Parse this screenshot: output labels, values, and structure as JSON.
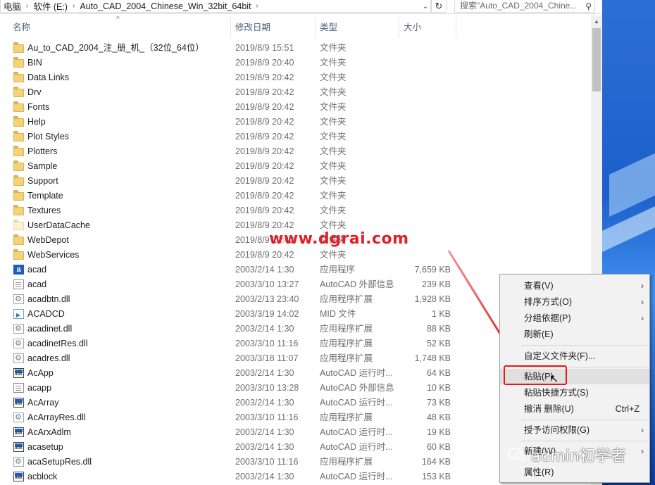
{
  "address": {
    "segments": [
      "电脑",
      "软件 (E:)",
      "Auto_CAD_2004_Chinese_Win_32bit_64bit"
    ],
    "search_placeholder": "搜索\"Auto_CAD_2004_Chine..."
  },
  "columns": {
    "name": "名称",
    "date": "修改日期",
    "type": "类型",
    "size": "大小"
  },
  "files": [
    {
      "name": "Au_to_CAD_2004_注_册_机_（32位_64位）",
      "date": "2019/8/9 15:51",
      "type": "文件夹",
      "size": "",
      "icon": "folder"
    },
    {
      "name": "BIN",
      "date": "2019/8/9 20:40",
      "type": "文件夹",
      "size": "",
      "icon": "folder"
    },
    {
      "name": "Data Links",
      "date": "2019/8/9 20:42",
      "type": "文件夹",
      "size": "",
      "icon": "folder"
    },
    {
      "name": "Drv",
      "date": "2019/8/9 20:42",
      "type": "文件夹",
      "size": "",
      "icon": "folder"
    },
    {
      "name": "Fonts",
      "date": "2019/8/9 20:42",
      "type": "文件夹",
      "size": "",
      "icon": "folder"
    },
    {
      "name": "Help",
      "date": "2019/8/9 20:42",
      "type": "文件夹",
      "size": "",
      "icon": "folder"
    },
    {
      "name": "Plot Styles",
      "date": "2019/8/9 20:42",
      "type": "文件夹",
      "size": "",
      "icon": "folder"
    },
    {
      "name": "Plotters",
      "date": "2019/8/9 20:42",
      "type": "文件夹",
      "size": "",
      "icon": "folder"
    },
    {
      "name": "Sample",
      "date": "2019/8/9 20:42",
      "type": "文件夹",
      "size": "",
      "icon": "folder"
    },
    {
      "name": "Support",
      "date": "2019/8/9 20:42",
      "type": "文件夹",
      "size": "",
      "icon": "folder"
    },
    {
      "name": "Template",
      "date": "2019/8/9 20:42",
      "type": "文件夹",
      "size": "",
      "icon": "folder"
    },
    {
      "name": "Textures",
      "date": "2019/8/9 20:42",
      "type": "文件夹",
      "size": "",
      "icon": "folder"
    },
    {
      "name": "UserDataCache",
      "date": "2019/8/9 20:42",
      "type": "文件夹",
      "size": "",
      "icon": "folder-light"
    },
    {
      "name": "WebDepot",
      "date": "2019/8/9 20:42",
      "type": "文件夹",
      "size": "",
      "icon": "folder"
    },
    {
      "name": "WebServices",
      "date": "2019/8/9 20:42",
      "type": "文件夹",
      "size": "",
      "icon": "folder"
    },
    {
      "name": "acad",
      "date": "2003/2/14 1:30",
      "type": "应用程序",
      "size": "7,659 KB",
      "icon": "exe"
    },
    {
      "name": "acad",
      "date": "2003/3/10 13:27",
      "type": "AutoCAD 外部信息",
      "size": "239 KB",
      "icon": "doc"
    },
    {
      "name": "acadbtn.dll",
      "date": "2003/2/13 23:40",
      "type": "应用程序扩展",
      "size": "1,928 KB",
      "icon": "dll"
    },
    {
      "name": "ACADCD",
      "date": "2003/3/19 14:02",
      "type": "MID 文件",
      "size": "1 KB",
      "icon": "mid"
    },
    {
      "name": "acadinet.dll",
      "date": "2003/2/14 1:30",
      "type": "应用程序扩展",
      "size": "88 KB",
      "icon": "dll"
    },
    {
      "name": "acadinetRes.dll",
      "date": "2003/3/10 11:16",
      "type": "应用程序扩展",
      "size": "52 KB",
      "icon": "dll"
    },
    {
      "name": "acadres.dll",
      "date": "2003/3/18 11:07",
      "type": "应用程序扩展",
      "size": "1,748 KB",
      "icon": "dll"
    },
    {
      "name": "AcApp",
      "date": "2003/2/14 1:30",
      "type": "AutoCAD 运行时...",
      "size": "64 KB",
      "icon": "arx"
    },
    {
      "name": "acapp",
      "date": "2003/3/10 13:28",
      "type": "AutoCAD 外部信息",
      "size": "10 KB",
      "icon": "doc"
    },
    {
      "name": "AcArray",
      "date": "2003/2/14 1:30",
      "type": "AutoCAD 运行时...",
      "size": "73 KB",
      "icon": "arx"
    },
    {
      "name": "AcArrayRes.dll",
      "date": "2003/3/10 11:16",
      "type": "应用程序扩展",
      "size": "48 KB",
      "icon": "dll"
    },
    {
      "name": "AcArxAdlm",
      "date": "2003/2/14 1:30",
      "type": "AutoCAD 运行时...",
      "size": "19 KB",
      "icon": "arx"
    },
    {
      "name": "acasetup",
      "date": "2003/2/14 1:30",
      "type": "AutoCAD 运行时...",
      "size": "60 KB",
      "icon": "arx"
    },
    {
      "name": "acaSetupRes.dll",
      "date": "2003/3/10 11:16",
      "type": "应用程序扩展",
      "size": "164 KB",
      "icon": "dll"
    },
    {
      "name": "acblock",
      "date": "2003/2/14 1:30",
      "type": "AutoCAD 运行时...",
      "size": "153 KB",
      "icon": "arx"
    }
  ],
  "watermark": "www.dgrai.com",
  "watermark2": "admin初学者",
  "context_menu": {
    "view": "查看(V)",
    "sort": "排序方式(O)",
    "group": "分组依据(P)",
    "refresh": "刷新(E)",
    "customize": "自定义文件夹(F)...",
    "paste": "粘贴(P)",
    "paste_shortcut": "粘贴快捷方式(S)",
    "undo": "撤消 删除(U)",
    "undo_shortcut": "Ctrl+Z",
    "access": "授予访问权限(G)",
    "new": "新建(W)",
    "properties": "属性(R)"
  },
  "colors": {
    "highlight_box": "#e01c1c",
    "watermark": "#e31e24",
    "header_text": "#4c607a"
  }
}
